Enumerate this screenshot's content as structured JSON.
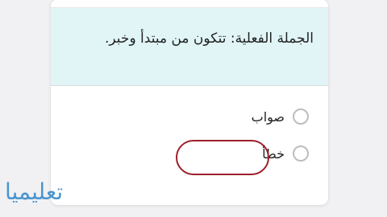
{
  "question": {
    "text": "الجملة الفعلية: تتكون من مبتدأ وخبر."
  },
  "options": [
    {
      "label": "صواب"
    },
    {
      "label": "خطأ"
    }
  ],
  "watermark": "تعليميا",
  "colors": {
    "question_bg": "#e1f5f7",
    "highlight_border": "#9c1f2a",
    "watermark": "#4a95cf"
  }
}
